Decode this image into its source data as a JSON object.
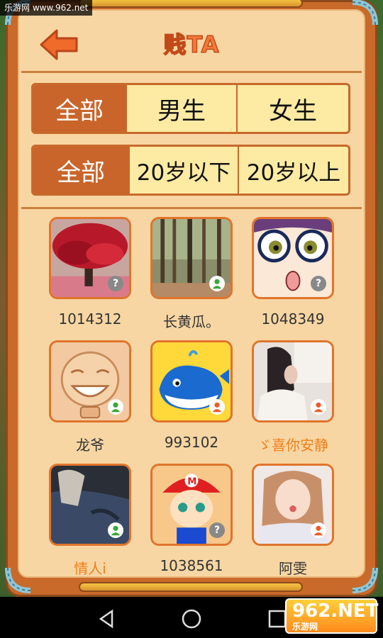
{
  "watermark_top": "乐游网 www.962.net",
  "header": {
    "title": "贱TA"
  },
  "gender_filter": {
    "options": [
      "全部",
      "男生",
      "女生"
    ],
    "selected": 0
  },
  "age_filter": {
    "options": [
      "全部",
      "20岁以下",
      "20岁以上"
    ],
    "selected": 0
  },
  "users": [
    {
      "name": "1014312",
      "gender": "unknown",
      "name_color": "normal",
      "art": "red-tree"
    },
    {
      "name": "长黄瓜。",
      "gender": "male",
      "name_color": "normal",
      "art": "bamboo"
    },
    {
      "name": "1048349",
      "gender": "unknown",
      "name_color": "normal",
      "art": "glasses-girl"
    },
    {
      "name": "龙爷",
      "gender": "male",
      "name_color": "normal",
      "art": "sketch-face"
    },
    {
      "name": "993102",
      "gender": "female",
      "name_color": "normal",
      "art": "whale"
    },
    {
      "name": "ゞ喜你安静",
      "gender": "female",
      "name_color": "orange",
      "art": "photo-girl"
    },
    {
      "name": "情人i",
      "gender": "male",
      "name_color": "orange",
      "art": "jeans"
    },
    {
      "name": "1038561",
      "gender": "unknown",
      "name_color": "normal",
      "art": "mario-kid"
    },
    {
      "name": "阿雯",
      "gender": "female",
      "name_color": "normal",
      "art": "selfie-girl"
    }
  ],
  "watermark_bottom": {
    "main": "962.NET",
    "sub": "乐游网"
  },
  "colors": {
    "accent": "#c9652b",
    "panel": "#f7d6a3",
    "orange_name": "#f07f1c"
  }
}
